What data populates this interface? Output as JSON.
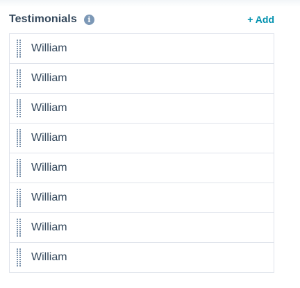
{
  "section": {
    "title": "Testimonials",
    "info_icon": "info-circle-icon",
    "add_label": "+ Add"
  },
  "testimonials": [
    {
      "label": "William"
    },
    {
      "label": "William"
    },
    {
      "label": "William"
    },
    {
      "label": "William"
    },
    {
      "label": "William"
    },
    {
      "label": "William"
    },
    {
      "label": "William"
    },
    {
      "label": "William"
    }
  ],
  "colors": {
    "accent": "#0091ae",
    "text": "#33475b",
    "border": "#dfe3eb",
    "icon": "#7c98b6"
  }
}
